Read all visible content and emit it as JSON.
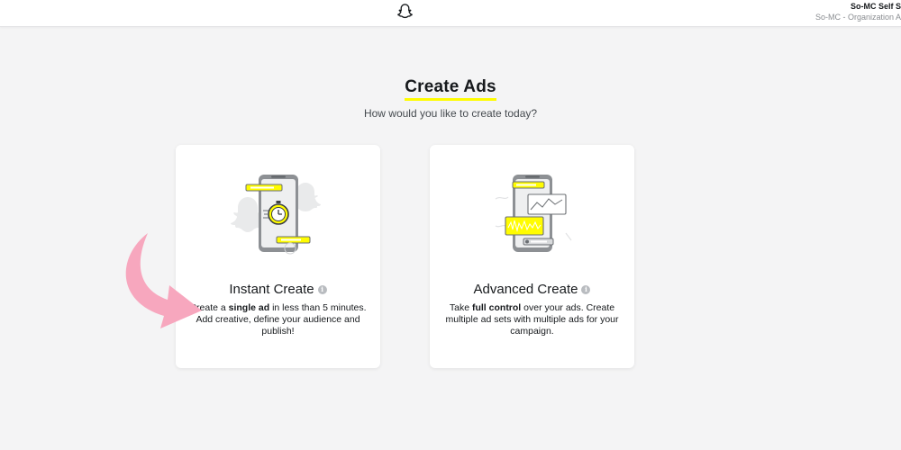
{
  "header": {
    "account_name": "So-MC Self S",
    "account_org": "So-MC - Organization A",
    "logo_icon": "snapchat-ghost-icon"
  },
  "page": {
    "title": "Create Ads",
    "subtitle": "How would you like to create today?",
    "accent_color": "#fffc00"
  },
  "options": [
    {
      "title": "Instant Create",
      "info_icon": "info-icon",
      "desc_pre": "Create a ",
      "desc_bold": "single ad",
      "desc_post": " in less than 5 minutes. Add creative, define your audience and publish!",
      "illustration": "phone-stopwatch-icon"
    },
    {
      "title": "Advanced Create",
      "info_icon": "info-icon",
      "desc_pre": "Take ",
      "desc_bold": "full control",
      "desc_post": " over your ads. Create multiple ad sets with multiple ads for your campaign.",
      "illustration": "phone-chart-icon"
    }
  ],
  "annotation": {
    "arrow_icon": "curved-arrow-icon",
    "arrow_color": "#f7a7be"
  }
}
